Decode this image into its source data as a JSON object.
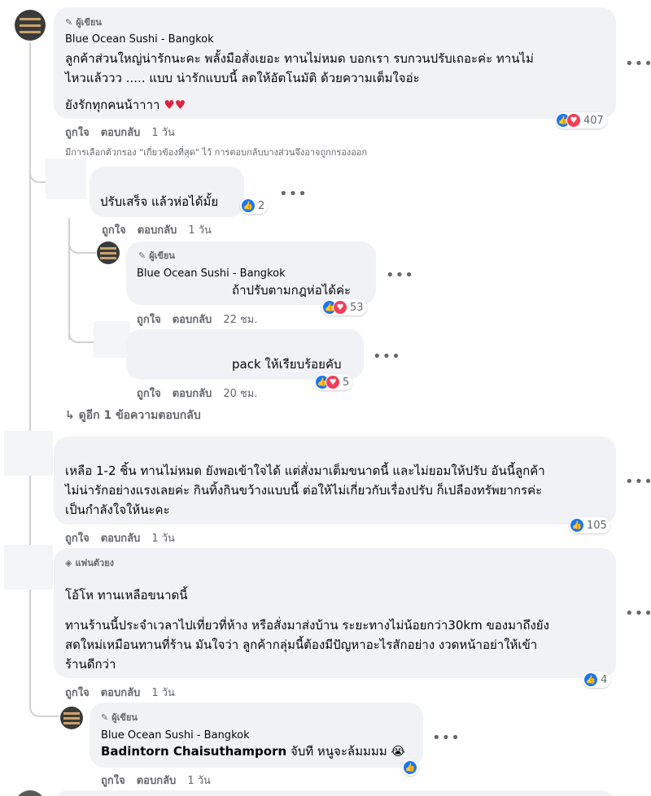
{
  "author_badge": "ผู้เขียน",
  "fan_badge": "แฟนตัวยง",
  "c1": {
    "name": "Blue Ocean Sushi - Bangkok",
    "text_l1": "ลูกค้าส่วนใหญ่น่ารักนะคะ พลั้งมือสั่งเยอะ ทานไม่หมด บอกเรา รบกวนปรับเถอะค่ะ ทานไม่",
    "text_l2": "ไหวแล้ววว ..... แบบ น่ารักแบบนี้ ลดให้อัตโนมัติ ด้วยความเต็มใจอ่ะ",
    "text_l3": "ยังรักทุกคนน้าาาา ♥♥",
    "like": "ถูกใจ",
    "reply": "ตอบกลับ",
    "time": "1 วัน",
    "reactions": "407"
  },
  "filter_note": "มีการเลือกตัวกรอง \"เกี่ยวข้องที่สุด\" ไว้ การตอบกลับบางส่วนจึงอาจถูกกรองออก",
  "r1": {
    "text": "ปรับเสร็จ แล้วห่อได้มั้ย",
    "like": "ถูกใจ",
    "reply": "ตอบกลับ",
    "time": "1 วัน",
    "reactions": "2"
  },
  "r2": {
    "name": "Blue Ocean Sushi - Bangkok",
    "text": "ถ้าปรับตามกฎห่อได้ค่ะ",
    "like": "ถูกใจ",
    "reply": "ตอบกลับ",
    "time": "22 ชม.",
    "reactions": "53"
  },
  "r3": {
    "text": "pack ให้เรียบร้อยคับ",
    "like": "ถูกใจ",
    "reply": "ตอบกลับ",
    "time": "20 ชม.",
    "reactions": "5"
  },
  "more_replies": "ดูอีก 1 ข้อความตอบกลับ",
  "c2": {
    "text_l1": "เหลือ 1-2 ชิ้น ทานไม่หมด ยังพอเข้าใจได้ แต่สั่งมาเต็มขนาดนี้ และไม่ยอมให้ปรับ อันนี้ลูกค้า",
    "text_l2": "ไม่น่ารักอย่างแรงเลยค่ะ กินทิ้งกินขว้างแบบนี้ ต่อให้ไม่เกี่ยวกับเรื่องปรับ ก็เปลืองทรัพยากรค่ะ",
    "text_l3": "เป็นกำลังใจให้นะคะ",
    "like": "ถูกใจ",
    "reply": "ตอบกลับ",
    "time": "1 วัน",
    "reactions": "105"
  },
  "c3": {
    "text_l1": "โอ้โห ทานเหลือขนาดนี้",
    "text_l2": "ทานร้านนี้ประจำเวลาไปเที่ยวที่ห้าง หรือสั่งมาส่งบ้าน ระยะทางไม่น้อยกว่า30km ของมาถึงยัง",
    "text_l3": "สดใหม่เหมือนทานที่ร้าน มันใจว่า ลูกค้ากลุ่มนี้ต้องมีปัญหาอะไรสักอย่าง งวดหน้าอย่าให้เข้า",
    "text_l4": "ร้านดีกว่า",
    "like": "ถูกใจ",
    "reply": "ตอบกลับ",
    "time": "1 วัน",
    "reactions": "4"
  },
  "r4": {
    "name": "Blue Ocean Sushi - Bangkok",
    "mention": "Badintorn Chaisuthamporn",
    "text": " จับที หนูจะล้มมมม 😭",
    "like": "ถูกใจ",
    "reply": "ตอบกลับ",
    "time": "1 วัน"
  },
  "more_icon": "•••"
}
